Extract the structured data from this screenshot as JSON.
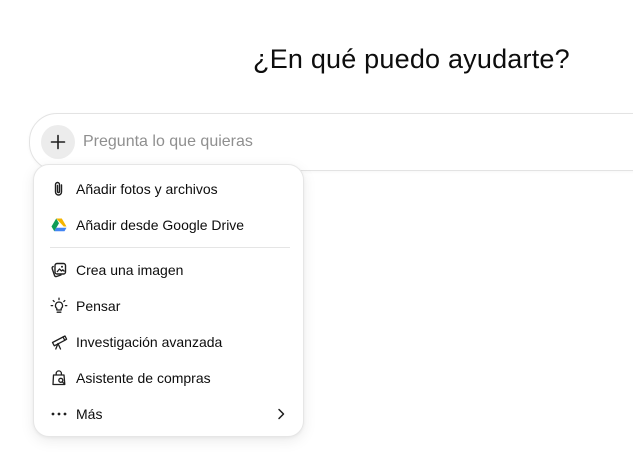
{
  "main": {
    "heading": "¿En qué puedo ayudarte?"
  },
  "composer": {
    "placeholder": "Pregunta lo que quieras",
    "value": "",
    "add_button_icon": "plus-icon"
  },
  "menu": {
    "items": [
      {
        "label": "Añadir fotos y archivos",
        "icon": "paperclip-icon"
      },
      {
        "label": "Añadir desde Google Drive",
        "icon": "google-drive-icon"
      },
      {
        "label": "Crea una imagen",
        "icon": "image-icon"
      },
      {
        "label": "Pensar",
        "icon": "lightbulb-icon"
      },
      {
        "label": "Investigación avanzada",
        "icon": "telescope-icon"
      },
      {
        "label": "Asistente de compras",
        "icon": "shopping-bag-icon"
      },
      {
        "label": "Más",
        "icon": "more-dots-icon",
        "submenu": true
      }
    ]
  },
  "colors": {
    "drive_green": "#0F9D58",
    "drive_yellow": "#F4B400",
    "drive_blue": "#4285F4",
    "text": "#0d0d0d",
    "placeholder": "#8f8f8f"
  }
}
